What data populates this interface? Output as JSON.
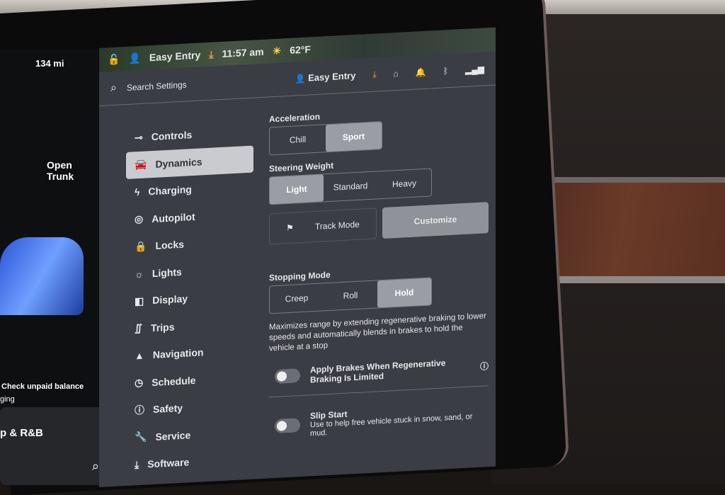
{
  "status_bar": {
    "range": "134 mi",
    "profile": "Easy Entry",
    "time": "11:57 am",
    "temperature": "62°F"
  },
  "left_panel": {
    "open_trunk": "Open\nTrunk",
    "alert": "Check unpaid balance",
    "alert_sub": "ging",
    "media": "p & R&B"
  },
  "header": {
    "search_placeholder": "Search Settings",
    "profile": "Easy Entry"
  },
  "sidebar": {
    "items": [
      {
        "label": "Controls",
        "icon": "toggle-icon"
      },
      {
        "label": "Dynamics",
        "icon": "car-icon",
        "active": true
      },
      {
        "label": "Charging",
        "icon": "bolt-icon"
      },
      {
        "label": "Autopilot",
        "icon": "steering-wheel-icon"
      },
      {
        "label": "Locks",
        "icon": "lock-icon"
      },
      {
        "label": "Lights",
        "icon": "sun-icon"
      },
      {
        "label": "Display",
        "icon": "display-icon"
      },
      {
        "label": "Trips",
        "icon": "trips-icon"
      },
      {
        "label": "Navigation",
        "icon": "navigation-icon"
      },
      {
        "label": "Schedule",
        "icon": "clock-icon"
      },
      {
        "label": "Safety",
        "icon": "alert-icon"
      },
      {
        "label": "Service",
        "icon": "wrench-icon"
      },
      {
        "label": "Software",
        "icon": "download-icon"
      }
    ]
  },
  "dynamics": {
    "acceleration": {
      "label": "Acceleration",
      "options": [
        "Chill",
        "Sport"
      ],
      "selected": "Sport"
    },
    "steering": {
      "label": "Steering Weight",
      "options": [
        "Light",
        "Standard",
        "Heavy"
      ],
      "selected": "Light"
    },
    "track_mode": "Track Mode",
    "customize": "Customize",
    "stopping": {
      "label": "Stopping Mode",
      "options": [
        "Creep",
        "Roll",
        "Hold"
      ],
      "selected": "Hold",
      "description": "Maximizes range by extending regenerative braking to lower speeds and automatically blends in brakes to hold the vehicle at a stop"
    },
    "apply_brakes": {
      "label": "Apply Brakes When Regenerative Braking Is Limited",
      "on": false
    },
    "slip_start": {
      "label": "Slip Start",
      "description": "Use to help free vehicle stuck in snow, sand, or mud.",
      "on": false
    }
  },
  "colors": {
    "screen_bg": "#3a3d43",
    "active_bg": "#c9cbcf",
    "download_accent": "#e8a040"
  }
}
